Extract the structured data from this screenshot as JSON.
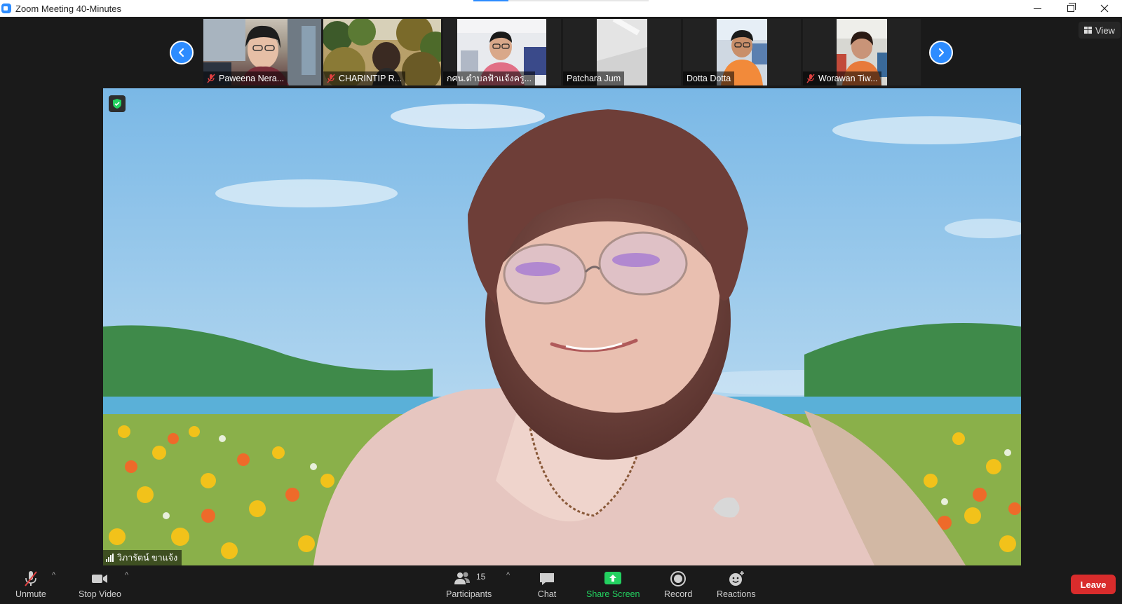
{
  "window": {
    "title": "Zoom Meeting 40-Minutes",
    "icon": "zoom-camera-icon"
  },
  "strip": {
    "prev_icon": "chevron-left-icon",
    "next_icon": "chevron-right-icon",
    "participants": [
      {
        "name": "Paweena Nera...",
        "muted": true
      },
      {
        "name": "CHARINTIP R...",
        "muted": true
      },
      {
        "name": "กศน.ตำบลฟ้าแจ้งครู...",
        "muted": false
      },
      {
        "name": "Patchara Jum",
        "muted": false
      },
      {
        "name": "Dotta Dotta",
        "muted": false
      },
      {
        "name": "Worawan Tiw...",
        "muted": true
      }
    ]
  },
  "view_button": {
    "label": "View",
    "icon": "grid-icon"
  },
  "main_video": {
    "speaker_name": "วิภารัตน์ ขาแจ้ง",
    "encryption_icon": "shield-check-icon",
    "encryption_color": "#23d160"
  },
  "toolbar": {
    "unmute": {
      "label": "Unmute",
      "icon": "mic-muted-icon"
    },
    "stop_video": {
      "label": "Stop Video",
      "icon": "video-camera-icon"
    },
    "participants": {
      "label": "Participants",
      "count": "15",
      "icon": "participants-icon"
    },
    "chat": {
      "label": "Chat",
      "icon": "chat-bubble-icon"
    },
    "share_screen": {
      "label": "Share Screen",
      "icon": "share-screen-icon",
      "color": "#23d160"
    },
    "record": {
      "label": "Record",
      "icon": "record-icon"
    },
    "reactions": {
      "label": "Reactions",
      "icon": "reactions-icon"
    },
    "leave": {
      "label": "Leave",
      "color": "#d92c2c"
    }
  },
  "colors": {
    "accent": "#2d8cff",
    "background": "#1a1a1a",
    "muted_red": "#e04040"
  }
}
